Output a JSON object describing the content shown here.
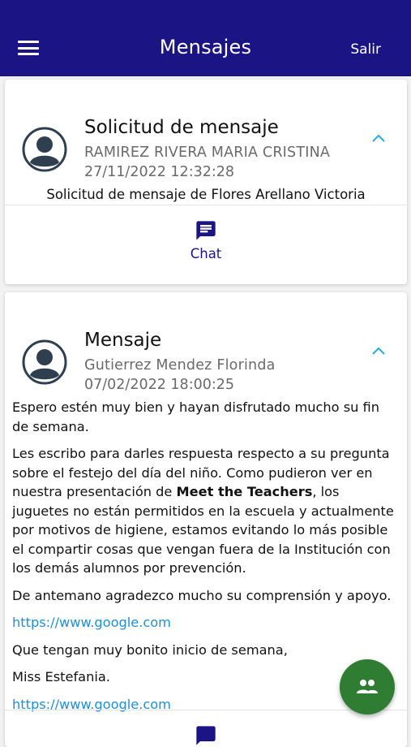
{
  "appbar": {
    "menu_icon": "hamburger-menu-icon",
    "title": "Mensajes",
    "logout_label": "Salir",
    "background_color": "#1b1485"
  },
  "messages": [
    {
      "title": "Solicitud de mensaje",
      "sender": "RAMIREZ RIVERA MARIA CRISTINA",
      "datetime": "27/11/2022 12:32:28",
      "snippet": "Solicitud de mensaje de Flores Arellano Victoria",
      "action_icon": "chat-icon",
      "action_label": "Chat",
      "expanded": true
    },
    {
      "title": "Mensaje",
      "sender": "Gutierrez Mendez Florinda",
      "datetime": "07/02/2022 18:00:25",
      "expanded": true,
      "body": {
        "p1": "Espero estén muy bien y hayan disfrutado mucho su fin de semana.",
        "p2_before": "Les escribo para darles respuesta respecto a su pregunta sobre el festejo del día del niño. Como pudieron ver en nuestra presentación de ",
        "p2_bold": "Meet the Teachers",
        "p2_after": ", los juguetes no están permitidos en la escuela y actualmente por motivos de higiene, estamos evitando lo más posible el compartir cosas que vengan fuera de la Institución con los demás alumnos por prevención.",
        "p3": "De antemano agradezco mucho su comprensión y apoyo.",
        "link1": "https://www.google.com",
        "p4": "Que tengan muy bonito inicio de semana,",
        "p5": "Miss Estefania.",
        "link2": "https://www.google.com"
      }
    }
  ],
  "fab": {
    "icon": "group-icon",
    "color": "#2e7d32"
  }
}
